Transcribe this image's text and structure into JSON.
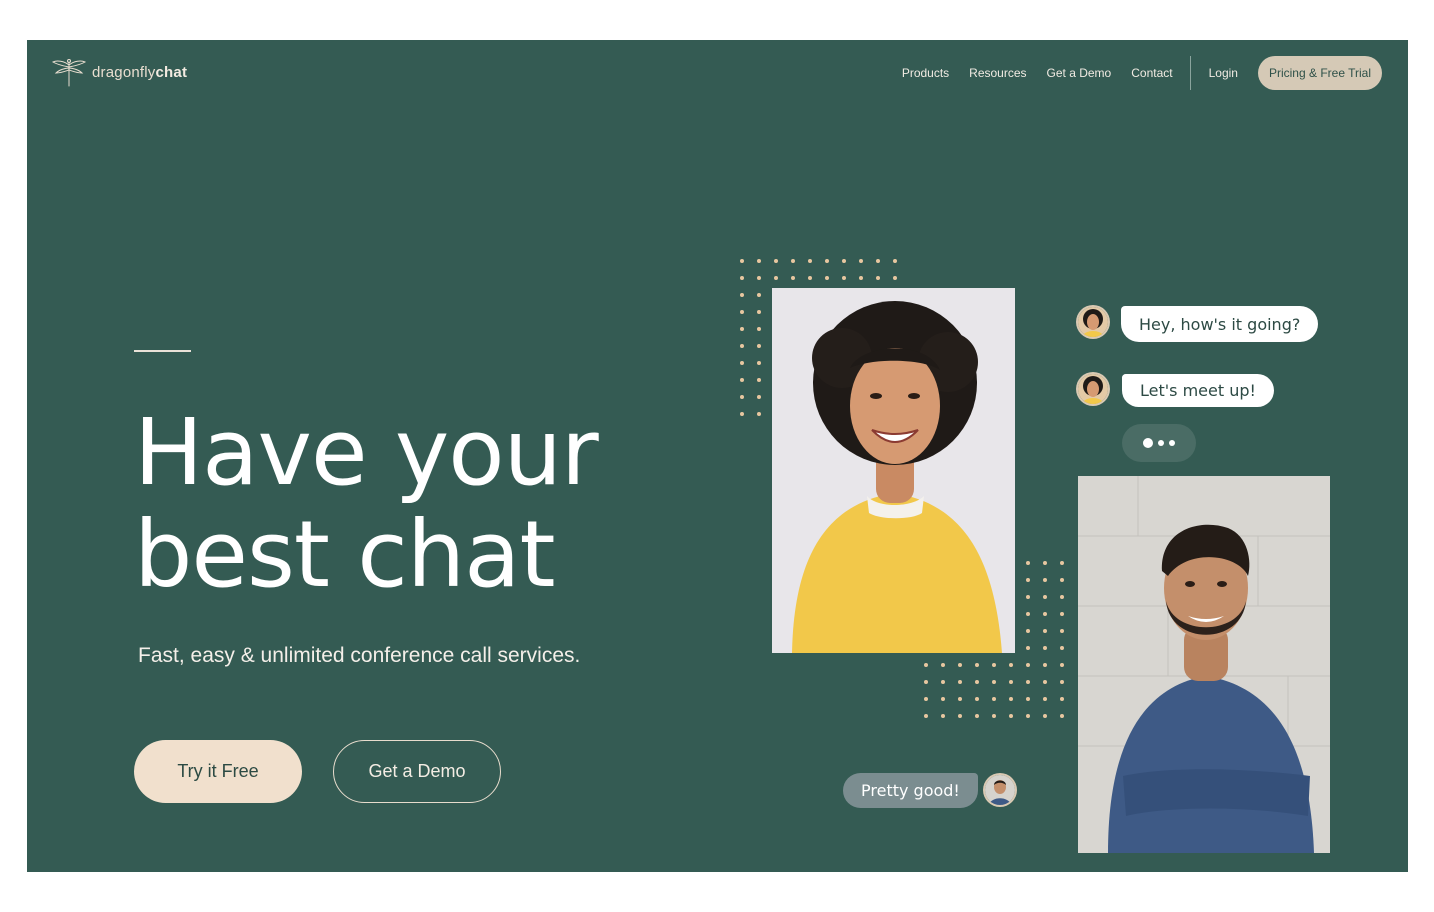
{
  "brand": {
    "logo_light": "dragonfly",
    "logo_bold": "chat"
  },
  "nav": {
    "items": [
      "Products",
      "Resources",
      "Get a Demo",
      "Contact"
    ],
    "login": "Login",
    "pricing_button": "Pricing & Free Trial"
  },
  "hero": {
    "headline_line1": "Have your",
    "headline_line2": "best chat",
    "subtitle": "Fast, easy & unlimited conference call services.",
    "primary_button": "Try it Free",
    "secondary_button": "Get a Demo"
  },
  "chat": {
    "message_1": "Hey, how's it going?",
    "message_2": "Let's meet up!",
    "typing_indicator": "typing-dots",
    "reply": "Pretty good!"
  },
  "colors": {
    "background": "#345b53",
    "accent_cream": "#f1e0cd",
    "pricing_button": "#d5c9b6",
    "dots": "#e8c7a0"
  },
  "icons": [
    "dragonfly-logo-icon"
  ]
}
